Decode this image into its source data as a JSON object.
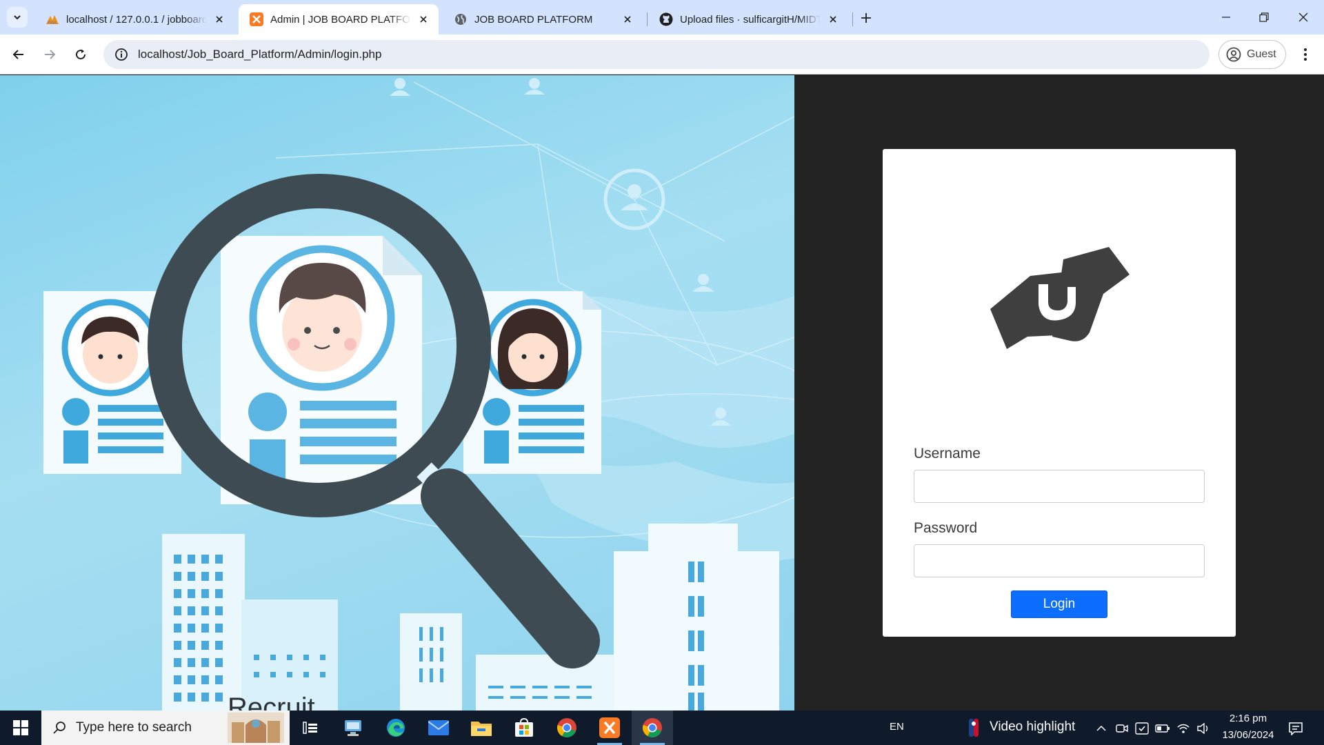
{
  "browser": {
    "tabs": [
      {
        "title": "localhost / 127.0.0.1 / jobboard",
        "favicon": "phpmyadmin-icon",
        "active": false
      },
      {
        "title": "Admin | JOB BOARD PLATFORM",
        "favicon": "xampp-icon",
        "active": true
      },
      {
        "title": "JOB BOARD PLATFORM",
        "favicon": "globe-icon",
        "active": false
      },
      {
        "title": "Upload files · sulficargitH/MIDT",
        "favicon": "github-icon",
        "active": false
      }
    ],
    "url": "localhost/Job_Board_Platform/Admin/login.php",
    "profile_label": "Guest"
  },
  "login": {
    "username_label": "Username",
    "username_value": "",
    "password_label": "Password",
    "password_value": "",
    "button_label": "Login",
    "button_color": "#0d6efd",
    "logo_icon": "handshake-icon"
  },
  "hero": {
    "illustration": "recruitment-magnifier-illustration",
    "bottom_text_partial": "Recruit"
  },
  "taskbar": {
    "search_placeholder": "Type here to search",
    "language": "EN",
    "news_label": "Video highlight",
    "time": "2:16 pm",
    "date": "13/06/2024"
  },
  "colors": {
    "tabstrip": "#d3e3fd",
    "page_background": "#222222",
    "hero_sky": "#8fd3ee",
    "taskbar": "#0f1a2a"
  }
}
